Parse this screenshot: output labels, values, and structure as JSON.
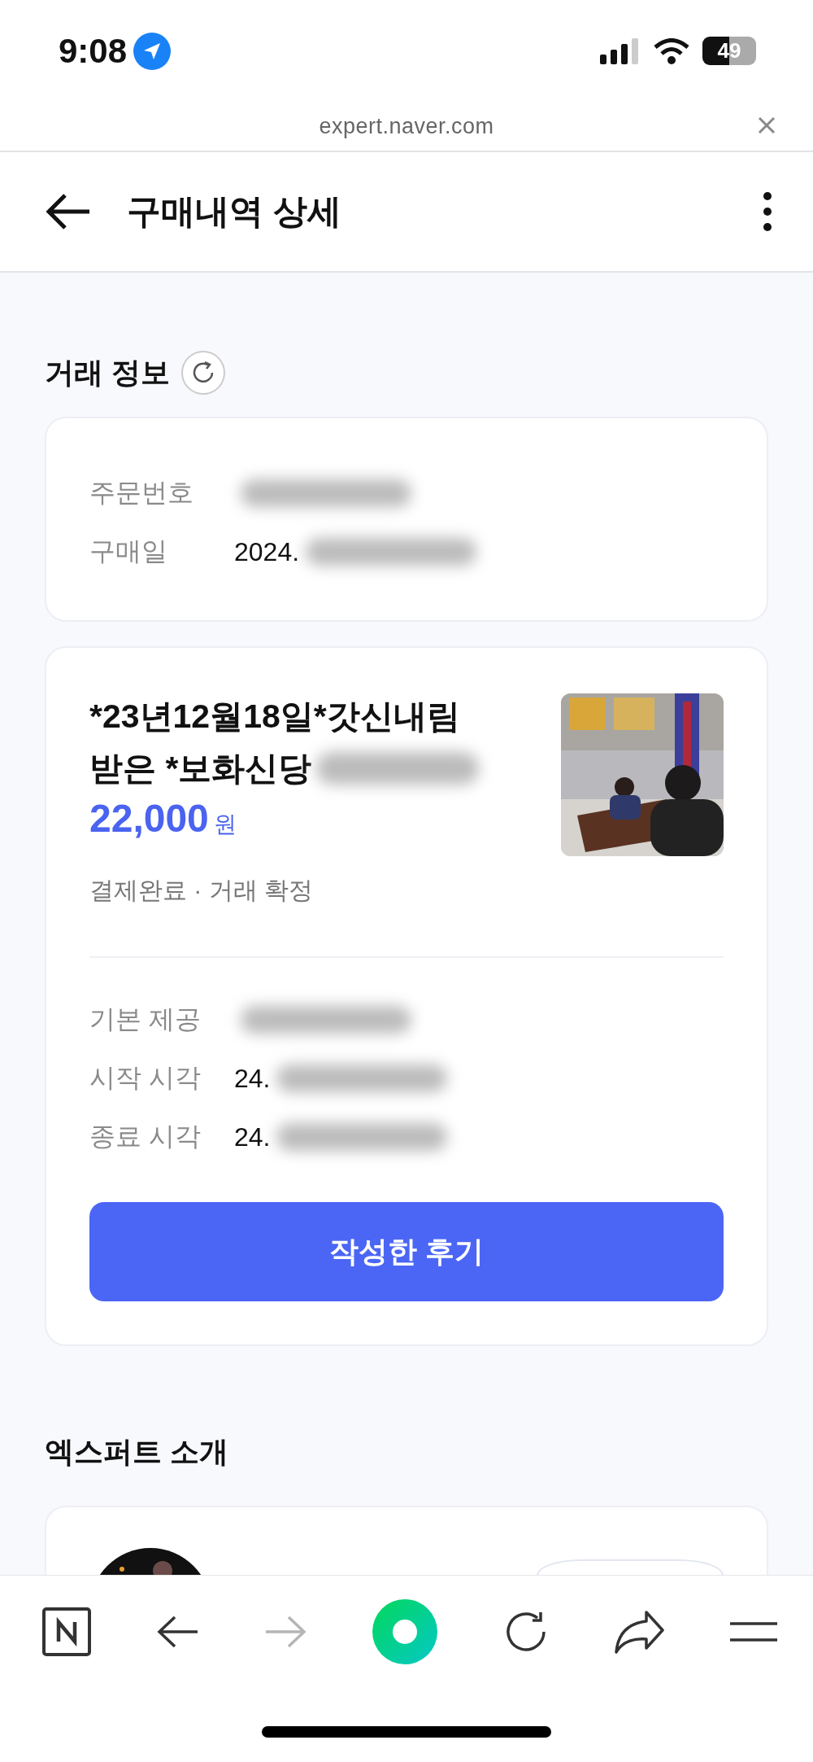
{
  "status_bar": {
    "time": "9:08",
    "battery": "49"
  },
  "address_bar": {
    "url": "expert.naver.com"
  },
  "header": {
    "title": "구매내역 상세"
  },
  "transaction": {
    "title": "거래 정보",
    "order_info": [
      {
        "label": "주문번호",
        "redacted": true
      },
      {
        "label": "구매일",
        "value": "2024.",
        "redacted": true
      }
    ],
    "product": {
      "title_lines": [
        "*23년12월18일*갓신내림",
        "받은 *보화신당"
      ],
      "title_redacted": true,
      "price": "22,000",
      "currency": "원",
      "status": "결제완료 · 거래 확정",
      "thumbnail": {
        "kind": "picture"
      }
    },
    "details": [
      {
        "label": "기본 제공",
        "redacted": true
      },
      {
        "label": "시작 시각",
        "value": "24.",
        "redacted": true
      },
      {
        "label": "종료 시각",
        "value": "24.",
        "redacted": true
      }
    ],
    "button": "작성한 후기"
  },
  "expert": {
    "title": "엑스퍼트 소개"
  },
  "toolbar": {
    "forward": {
      "disabled": true
    }
  }
}
